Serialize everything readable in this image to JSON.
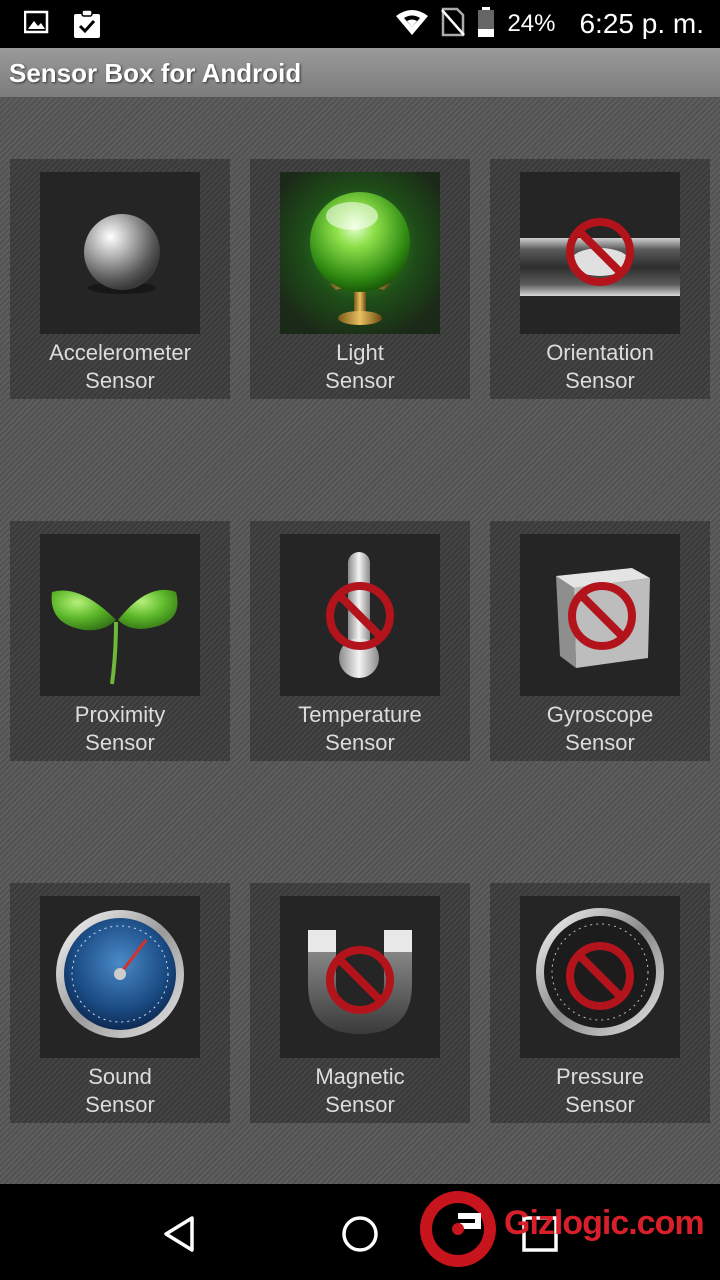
{
  "status_bar": {
    "battery_percent": "24%",
    "time": "6:25 p. m.",
    "icons": [
      "image-notification-icon",
      "clipboard-check-icon",
      "wifi-icon",
      "no-sim-icon",
      "battery-icon"
    ]
  },
  "app": {
    "title": "Sensor Box for Android"
  },
  "sensors": [
    {
      "line1": "Accelerometer",
      "line2": "Sensor",
      "icon": "metal-ball-icon",
      "available": true
    },
    {
      "line1": "Light",
      "line2": "Sensor",
      "icon": "green-crystal-ball-icon",
      "available": true
    },
    {
      "line1": "Orientation",
      "line2": "Sensor",
      "icon": "spirit-level-icon",
      "available": false
    },
    {
      "line1": "Proximity",
      "line2": "Sensor",
      "icon": "sprout-icon",
      "available": true
    },
    {
      "line1": "Temperature",
      "line2": "Sensor",
      "icon": "thermometer-icon",
      "available": false
    },
    {
      "line1": "Gyroscope",
      "line2": "Sensor",
      "icon": "cube-icon",
      "available": false
    },
    {
      "line1": "Sound",
      "line2": "Sensor",
      "icon": "sound-gauge-icon",
      "available": true
    },
    {
      "line1": "Magnetic",
      "line2": "Sensor",
      "icon": "magnet-icon",
      "available": false
    },
    {
      "line1": "Pressure",
      "line2": "Sensor",
      "icon": "pressure-gauge-icon",
      "available": false
    }
  ],
  "nav_bar": {
    "buttons": [
      "back-icon",
      "home-icon",
      "recents-icon"
    ]
  },
  "watermark": {
    "text": "Gizlogic.com"
  },
  "colors": {
    "unavailable_sign": "#b3141b",
    "watermark": "#d8202a"
  }
}
